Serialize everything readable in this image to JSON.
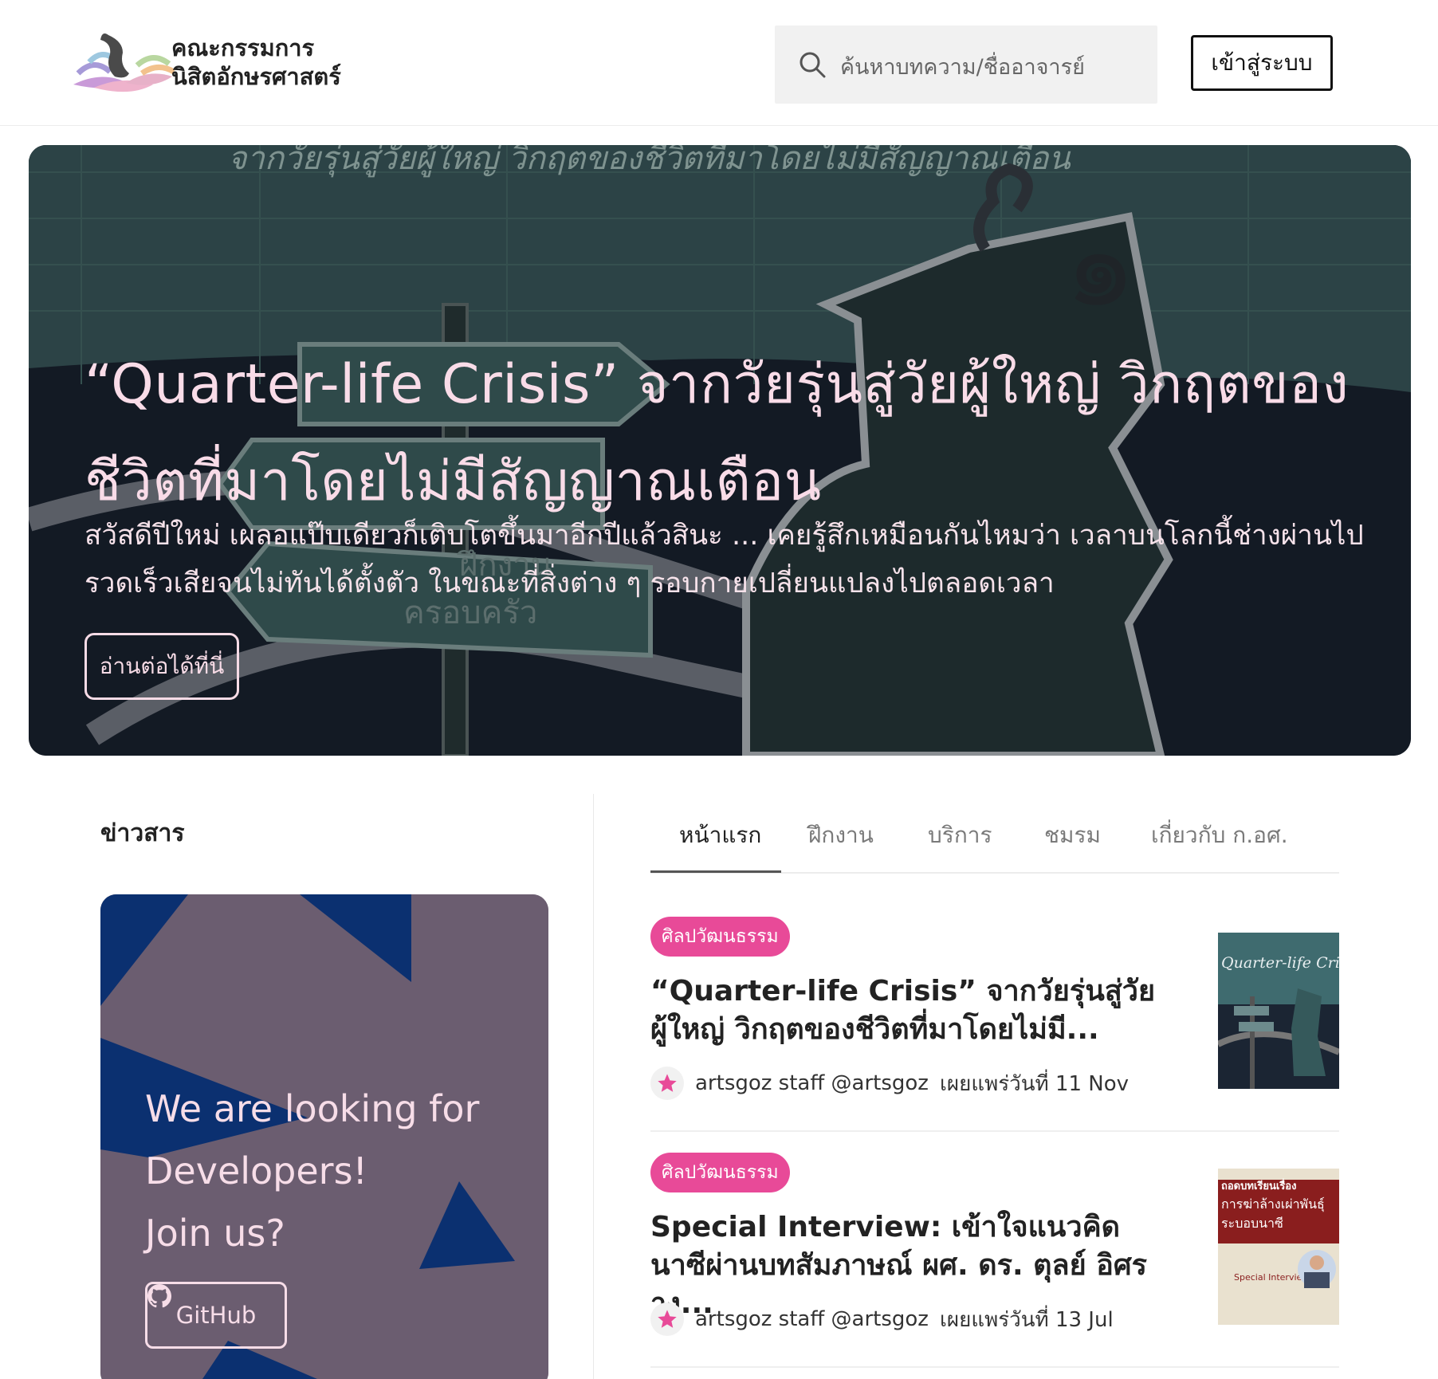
{
  "header": {
    "brand_line1": "คณะกรรมการ",
    "brand_line2": "นิสิตอักษรศาสตร์",
    "search_placeholder": "ค้นหาบทความ/ชื่ออาจารย์",
    "login_label": "เข้าสู่ระบบ"
  },
  "hero": {
    "title": "“Quarter-life Crisis” จากวัยรุ่นสู่วัยผู้ใหญ่ วิกฤตของชีวิตที่มาโดยไม่มีสัญญาณเตือน",
    "description": "สวัสดีปีใหม่ เผลอแป๊บเดียวก็เติบโตขึ้นมาอีกปีแล้วสินะ ... เคยรู้สึกเหมือนกันไหมว่า เวลาบนโลกนี้ช่างผ่านไปรวดเร็วเสียจนไม่ทันได้ตั้งตัว ในขณะที่สิ่งต่าง ๆ รอบกายเปลี่ยนแปลงไปตลอดเวลา",
    "read_more_label": "อ่านต่อได้ที่นี่",
    "background_text": {
      "top": "จากวัยรุ่นสู่วัยผู้ใหญ่ วิกฤตของชีวิตที่มาโดยไม่มีสัญญาณเตือน",
      "numeral": "๑",
      "sign_work": "ฝึกงาน",
      "sign_family": "ครอบครัว"
    }
  },
  "news": {
    "heading": "ข่าวสาร",
    "card_line1": "We are looking for",
    "card_line2": "Developers!",
    "card_line3": "Join us?",
    "github_label": "GitHub"
  },
  "tabs": [
    {
      "label": "หน้าแรก",
      "active": true
    },
    {
      "label": "ฝึกงาน",
      "active": false
    },
    {
      "label": "บริการ",
      "active": false
    },
    {
      "label": "ชมรม",
      "active": false
    },
    {
      "label": "เกี่ยวกับ ก.อศ.",
      "active": false
    }
  ],
  "articles": [
    {
      "badge": "ศิลปวัฒนธรรม",
      "title": "“Quarter-life Crisis” จากวัยรุ่นสู่วัยผู้ใหญ่ วิกฤตของชีวิตที่มาโดยไม่มี...",
      "author": "artsgoz staff @artsgoz",
      "date": "เผยแพร่วันที่ 11 Nov",
      "thumb_title": "Quarter-life Crisis"
    },
    {
      "badge": "ศิลปวัฒนธรรม",
      "title": "Special Interview: เข้าใจแนวคิดนาซีผ่านบทสัมภาษณ์ ผศ. ดร. ตุลย์ อิศราง...",
      "author": "artsgoz staff @artsgoz",
      "date": "เผยแพร่วันที่ 13 Jul",
      "thumb_line1": "ถอดบทเรียนเรื่อง",
      "thumb_line2": "การฆ่าล้างเผ่าพันธุ์",
      "thumb_line3": "ระบอบนาซี",
      "thumb_label": "Special Interview"
    }
  ],
  "colors": {
    "accent_pink": "#e84a98",
    "hero_text": "#f9dce8",
    "card_bg": "#6b5d70",
    "card_shape": "#0b3070"
  },
  "icons": [
    "logo-icon",
    "search-icon",
    "github-icon",
    "star-icon"
  ]
}
